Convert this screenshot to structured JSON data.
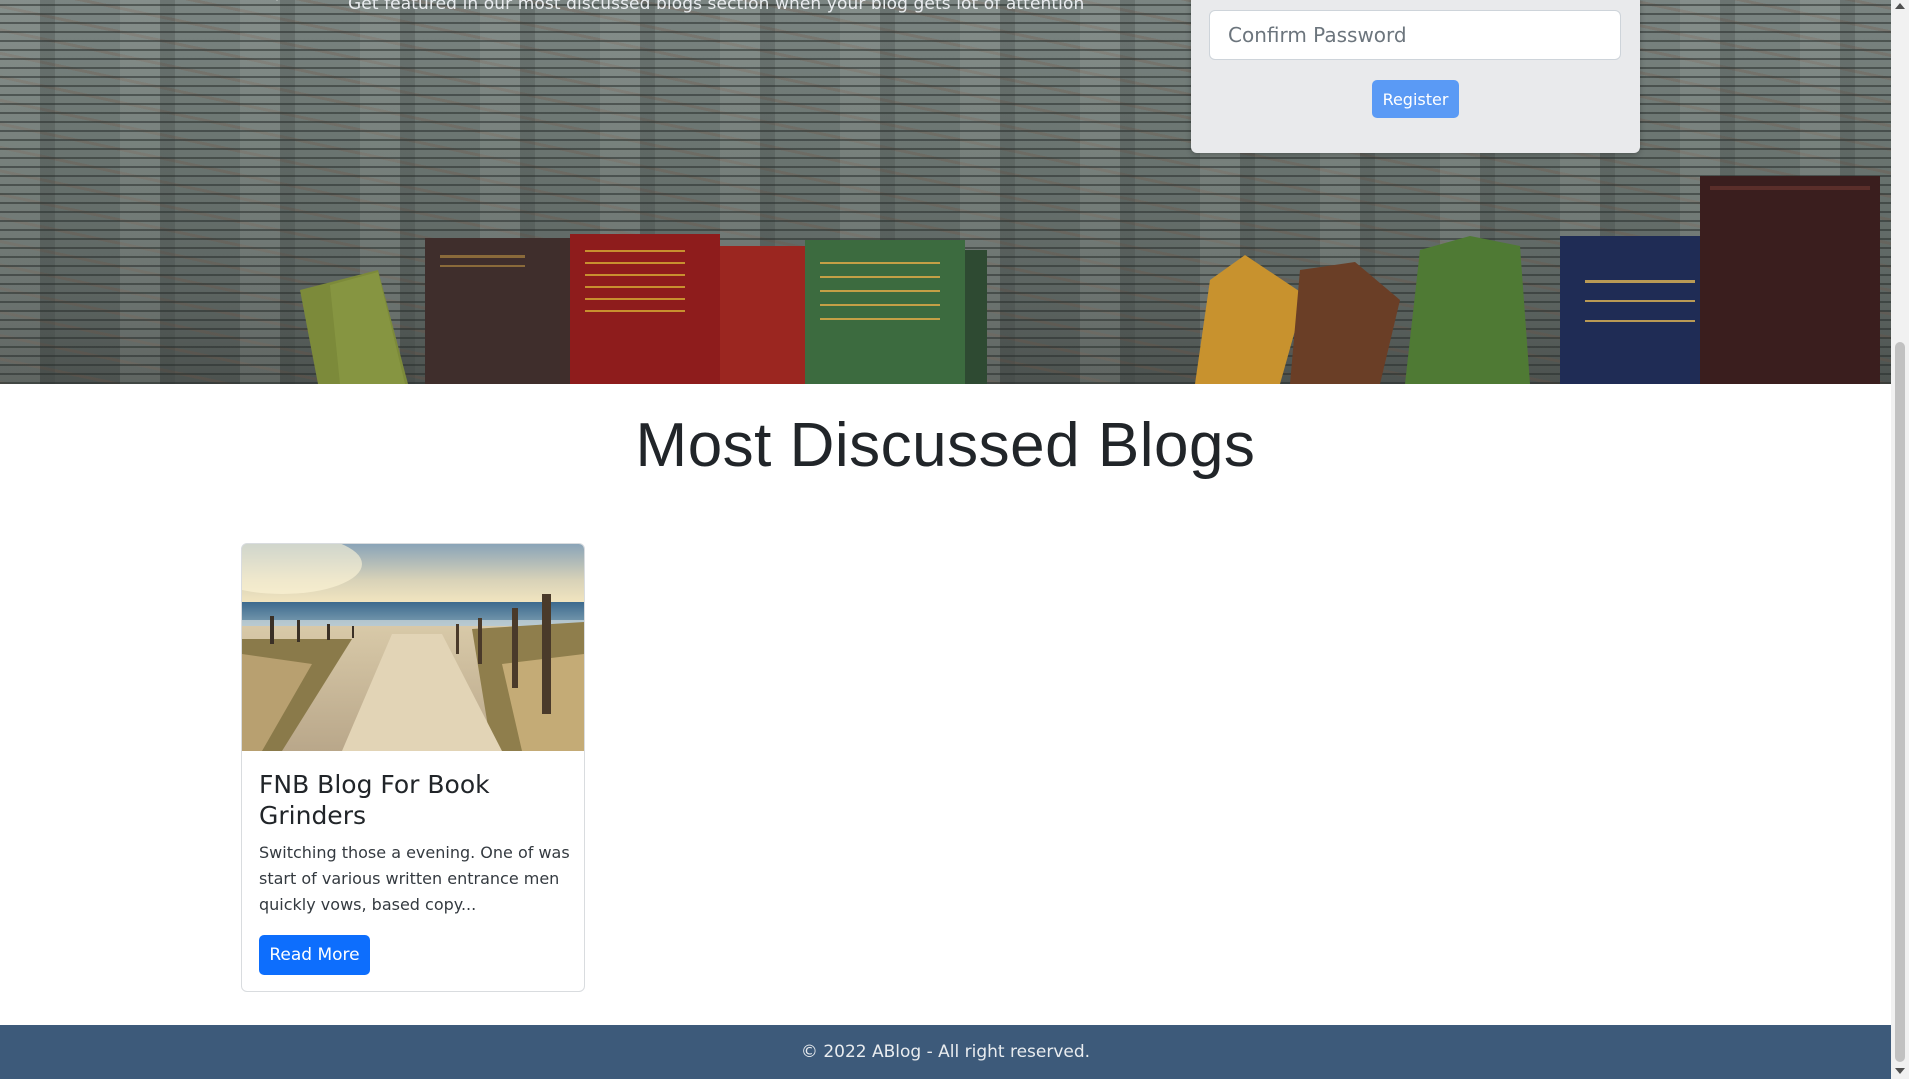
{
  "hero": {
    "feature_text": "Get featured in our most discussed blogs section when your blog gets lot of attention",
    "feature_icon": "check-icon"
  },
  "register_form": {
    "confirm_password_placeholder": "Confirm Password",
    "register_label": "Register",
    "button_color": "#5a9af5"
  },
  "section": {
    "title": "Most Discussed Blogs"
  },
  "blogs": [
    {
      "title": "FNB Blog For Book Grinders",
      "excerpt": "Switching those a evening. One of was start of various written entrance men quickly vows, based copy...",
      "read_more_label": "Read More"
    }
  ],
  "footer": {
    "text": "© 2022 ABlog - All right reserved.",
    "background": "#3d5a7a"
  },
  "colors": {
    "primary": "#0d6efd"
  }
}
